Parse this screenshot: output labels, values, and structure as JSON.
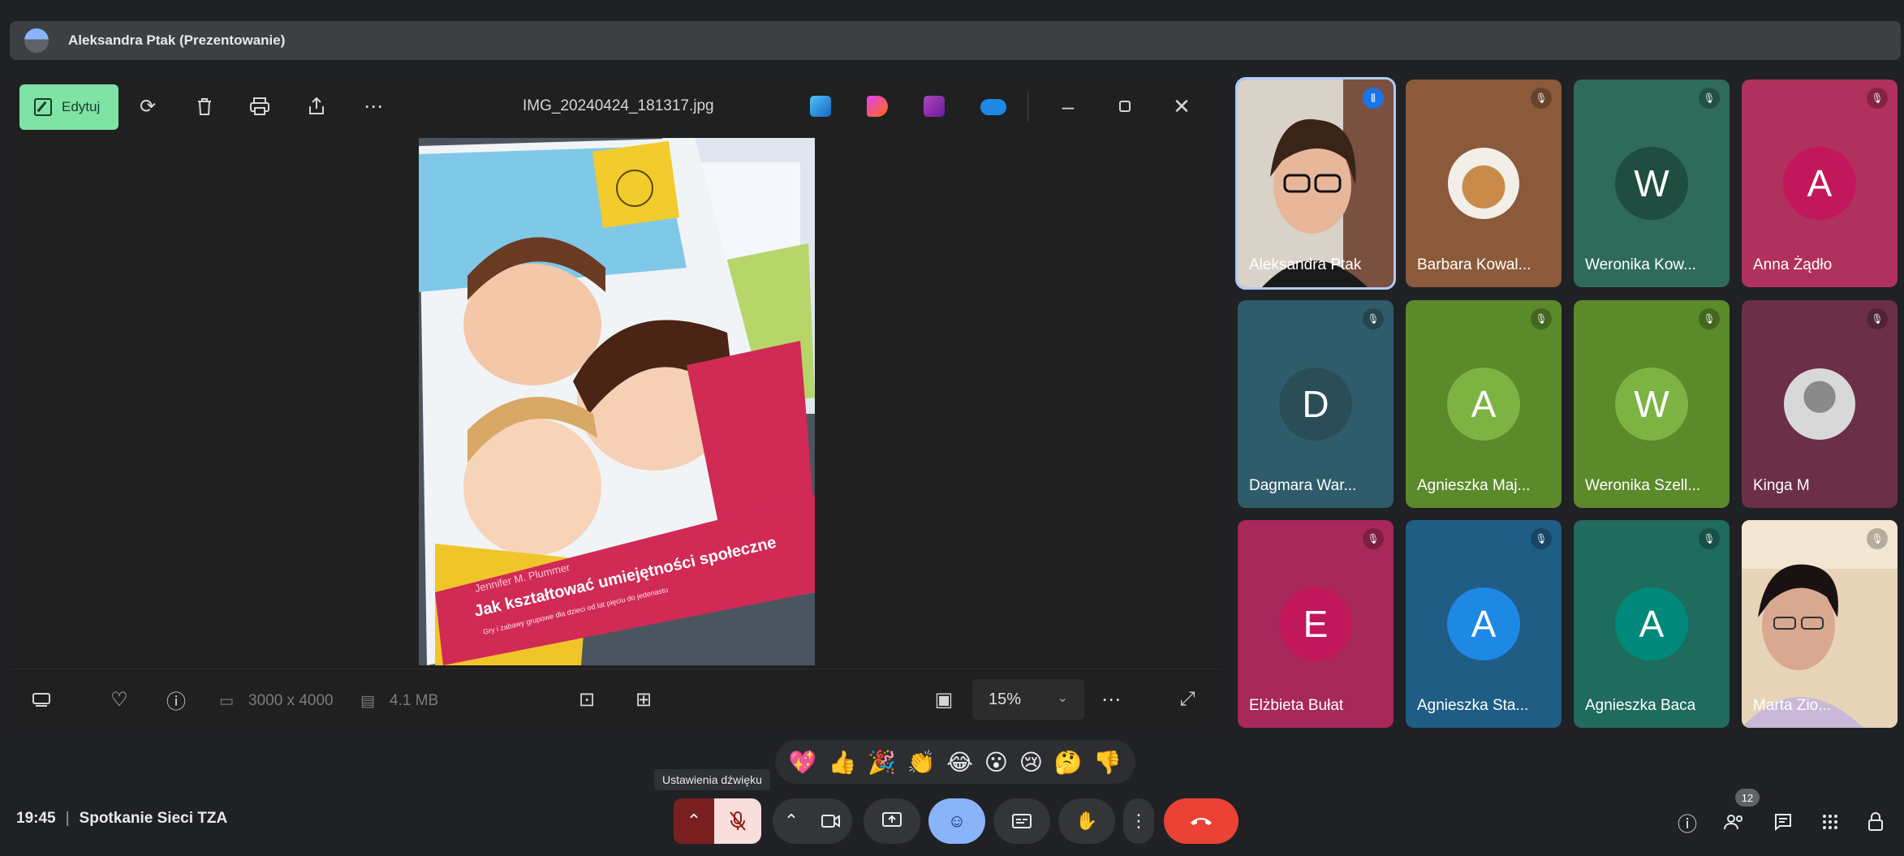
{
  "presenter_bar": {
    "label": "Aleksandra Ptak (Prezentowanie)"
  },
  "photos_app": {
    "edit_label": "Edytuj",
    "file_name": "IMG_20240424_181317.jpg",
    "status": {
      "dimensions": "3000 x 4000",
      "file_size": "4.1 MB",
      "zoom": "15%"
    },
    "book": {
      "author": "Jennifer M. Plummer",
      "title": "Jak kształtować umiejętności społeczne",
      "subtitle": "Gry i zabawy grupowe dla dzieci od lat pięciu do jedenastu"
    }
  },
  "participants": [
    {
      "name": "Aleksandra Ptak",
      "type": "video",
      "bg": "#4a3a30",
      "active_speaker": true
    },
    {
      "name": "Barbara Kowal...",
      "type": "photo",
      "bg": "#8a5a3a"
    },
    {
      "name": "Weronika Kow...",
      "initial": "W",
      "bg": "#2e6b5a",
      "avatar_bg": "#1f4d3f"
    },
    {
      "name": "Anna Żądło",
      "initial": "A",
      "bg": "#b0315d",
      "avatar_bg": "#c2185b"
    },
    {
      "name": "Dagmara War...",
      "initial": "D",
      "bg": "#2f5c6a",
      "avatar_bg": "#2b4d57"
    },
    {
      "name": "Agnieszka Maj...",
      "initial": "A",
      "bg": "#5a8a2a",
      "avatar_bg": "#7cb342"
    },
    {
      "name": "Weronika Szell...",
      "initial": "W",
      "bg": "#5a8a2a",
      "avatar_bg": "#7cb342"
    },
    {
      "name": "Kinga M",
      "type": "photo",
      "bg": "#6b2f48"
    },
    {
      "name": "Elżbieta Bułat",
      "initial": "E",
      "bg": "#a8285a",
      "avatar_bg": "#c2185b"
    },
    {
      "name": "Agnieszka Sta...",
      "initial": "A",
      "bg": "#1f5d85",
      "avatar_bg": "#1e88e5"
    },
    {
      "name": "Agnieszka Baca",
      "initial": "A",
      "bg": "#1f6b5e",
      "avatar_bg": "#00897b"
    },
    {
      "name": "Marta Zio...",
      "type": "video",
      "bg": "#c8a888"
    }
  ],
  "reactions": [
    "💖",
    "👍",
    "🎉",
    "👏",
    "😂",
    "😮",
    "😢",
    "🤔",
    "👎"
  ],
  "tooltip": "Ustawienia dźwięku",
  "meeting": {
    "time": "19:45",
    "name": "Spotkanie Sieci TZA"
  },
  "participant_count": "12",
  "colors": {
    "accent_green": "#7fe3a6",
    "end_call": "#ea4335",
    "emoji_active": "#8ab4f8"
  }
}
